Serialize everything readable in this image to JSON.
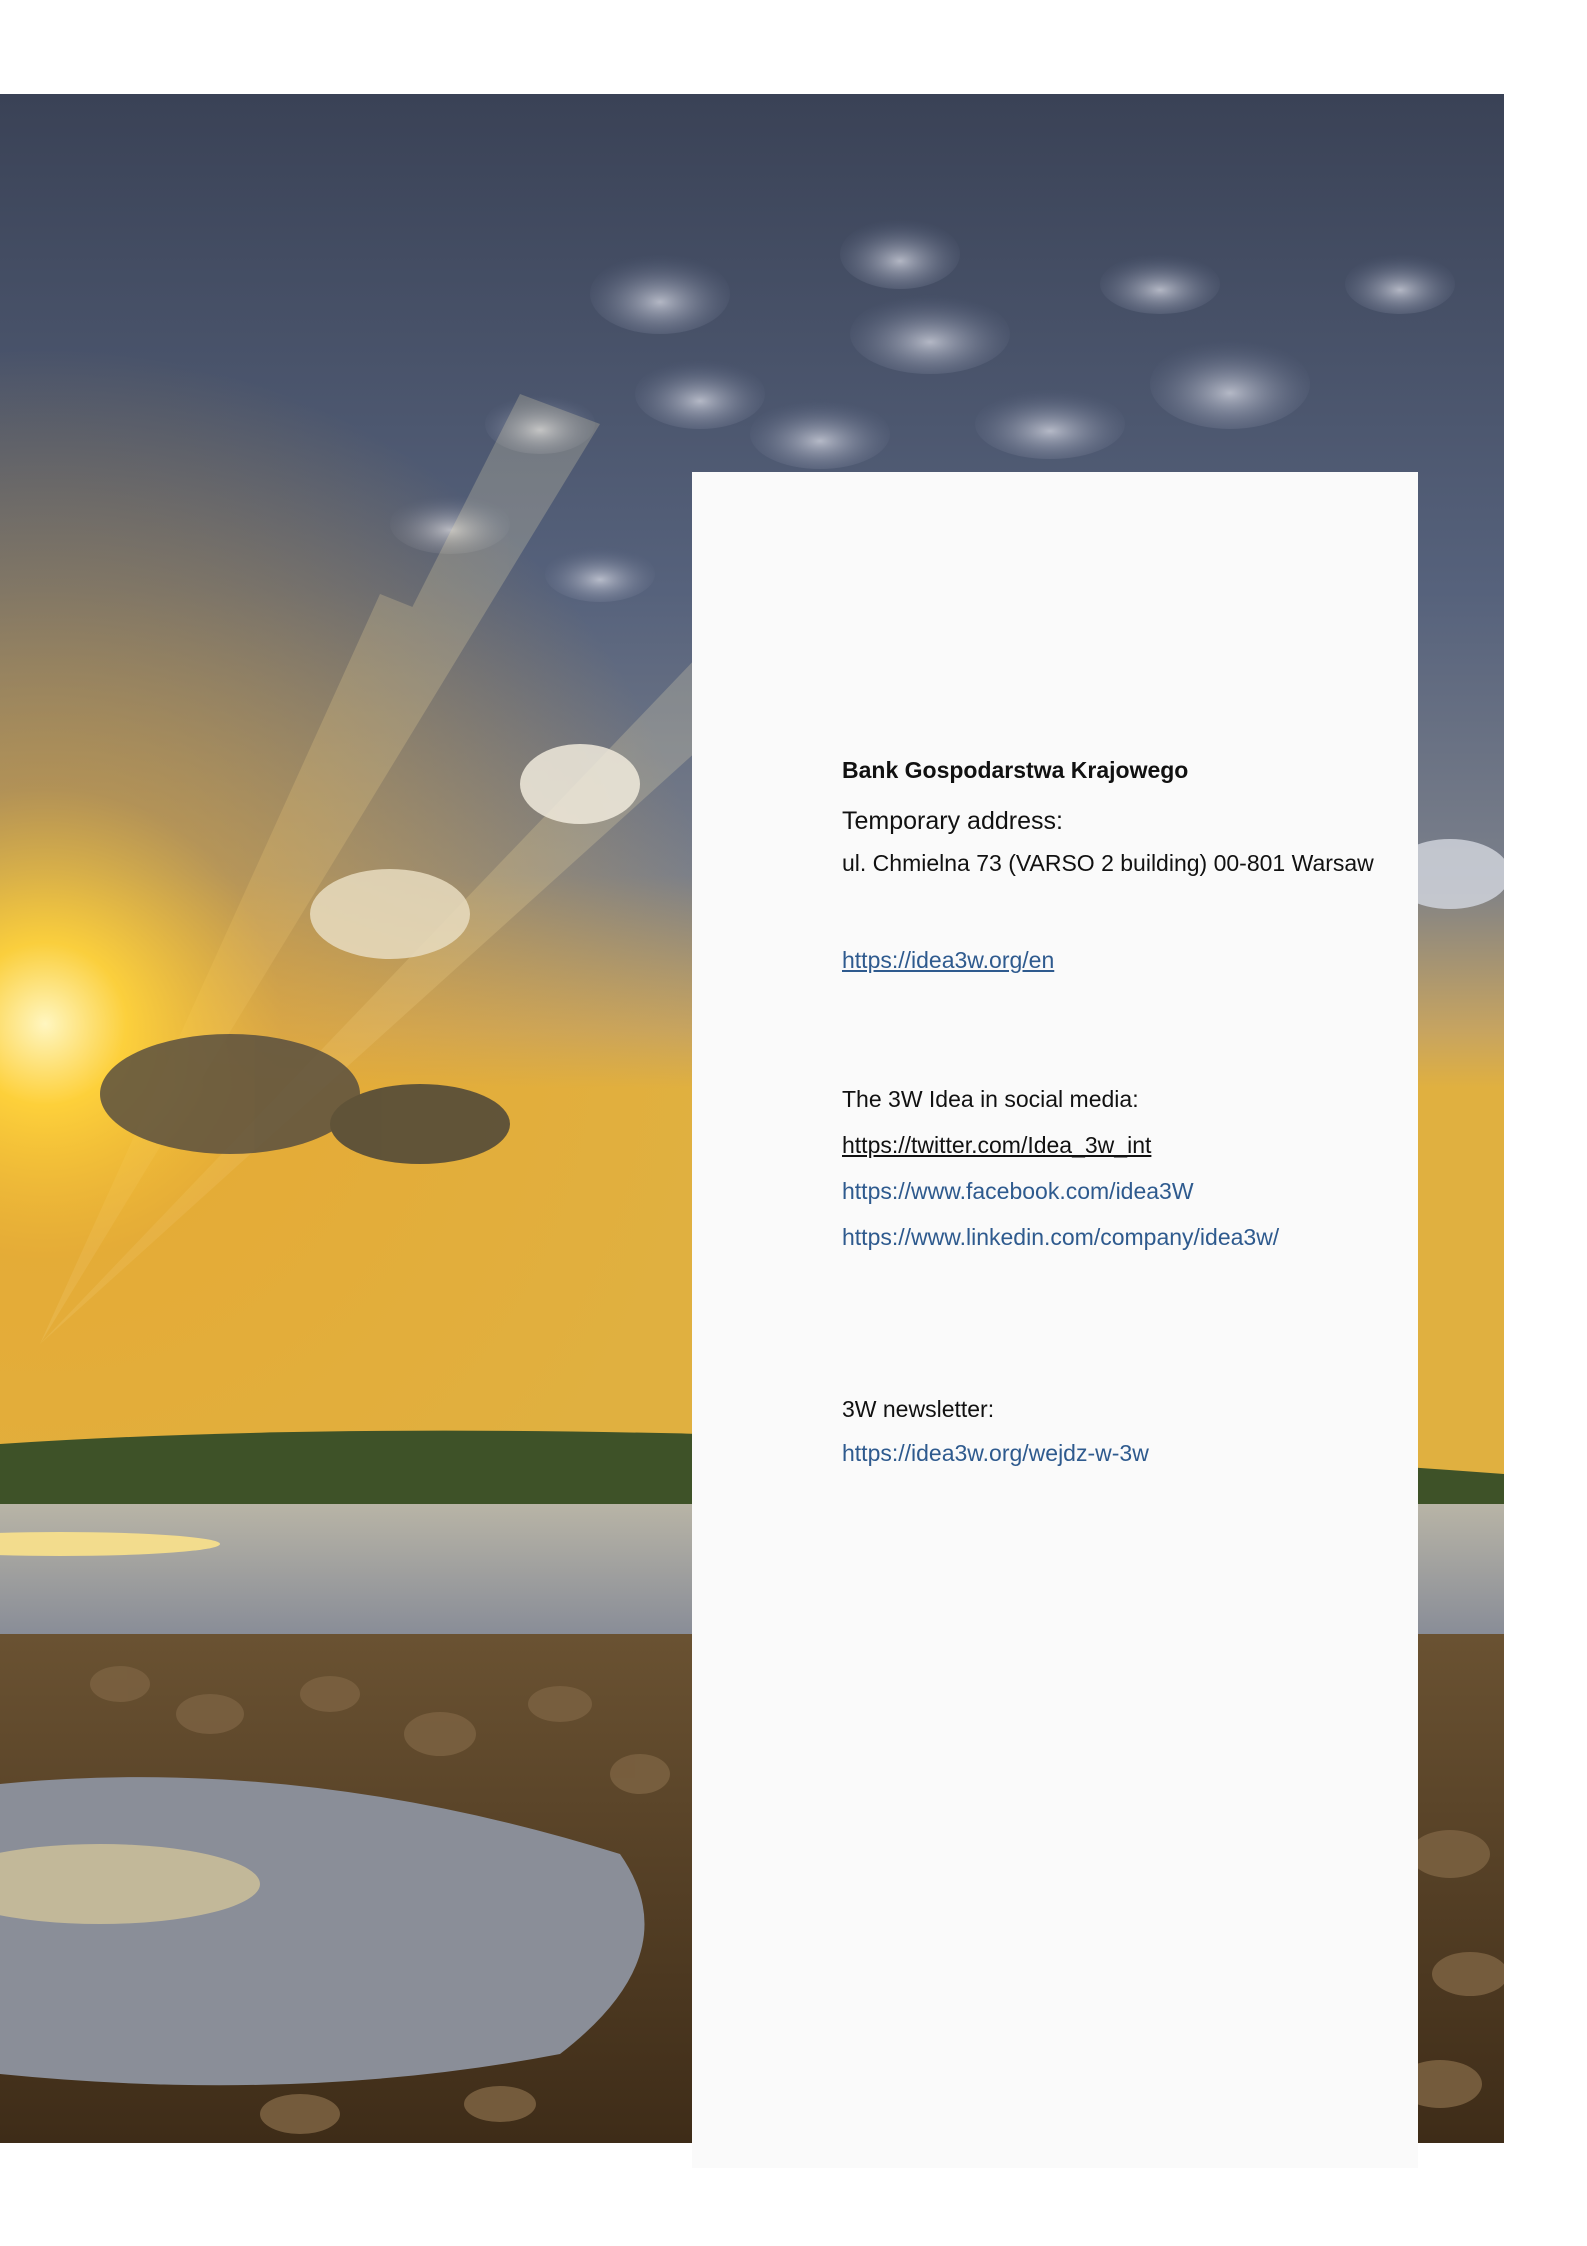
{
  "contact": {
    "organization": "Bank Gospodarstwa Krajowego",
    "address_label": "Temporary address:",
    "address": "ul. Chmielna 73 (VARSO 2 building) 00-801 Warsaw",
    "website": "https://idea3w.org/en",
    "social_label": "The 3W Idea in social media:",
    "social_links": [
      "https://twitter.com/Idea_3w_int",
      "https://www.facebook.com/idea3W",
      "https://www.linkedin.com/company/idea3w/"
    ],
    "newsletter_label": "3W newsletter:",
    "newsletter_link": "https://idea3w.org/wejdz-w-3w"
  },
  "colors": {
    "link_blue": "#2e5a8e",
    "card_background": "#fafafa",
    "sky": "#4f5a72",
    "sun": "#ffd23a",
    "water": "#9aa4b4",
    "ground": "#5a4328"
  }
}
